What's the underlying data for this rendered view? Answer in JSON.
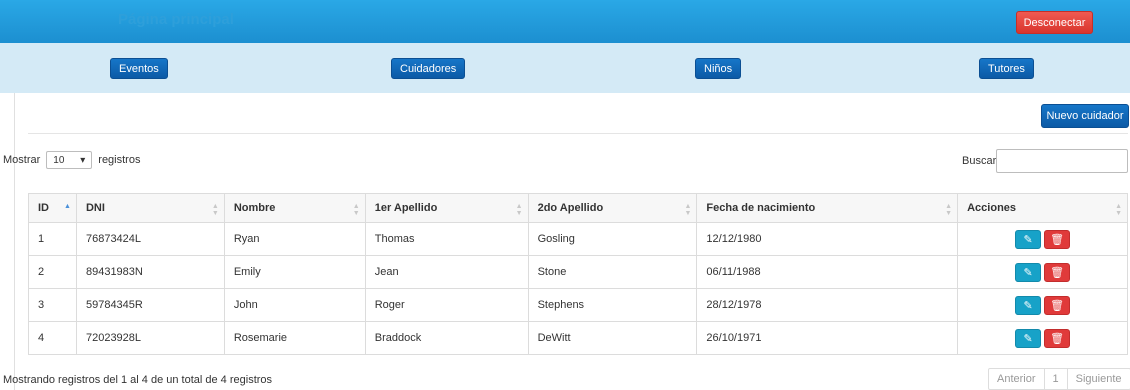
{
  "header": {
    "title": "Página principal",
    "logout_label": "Desconectar"
  },
  "nav": [
    {
      "label": "Eventos"
    },
    {
      "label": "Cuidadores"
    },
    {
      "label": "Niños"
    },
    {
      "label": "Tutores"
    }
  ],
  "toolbar": {
    "new_label": "Nuevo cuidador"
  },
  "controls": {
    "show_label": "Mostrar",
    "page_size": "10",
    "records_label": "registros",
    "search_label": "Buscar:",
    "search_value": ""
  },
  "table": {
    "columns": [
      "ID",
      "DNI",
      "Nombre",
      "1er Apellido",
      "2do Apellido",
      "Fecha de nacimiento",
      "Acciones"
    ],
    "rows": [
      [
        "1",
        "76873424L",
        "Ryan",
        "Thomas",
        "Gosling",
        "12/12/1980"
      ],
      [
        "2",
        "89431983N",
        "Emily",
        "Jean",
        "Stone",
        "06/11/1988"
      ],
      [
        "3",
        "59784345R",
        "John",
        "Roger",
        "Stephens",
        "28/12/1978"
      ],
      [
        "4",
        "72023928L",
        "Rosemarie",
        "Braddock",
        "DeWitt",
        "26/10/1971"
      ]
    ]
  },
  "footer": {
    "info": "Mostrando registros del 1 al 4 de un total de 4 registros",
    "prev": "Anterior",
    "page": "1",
    "next": "Siguiente"
  }
}
